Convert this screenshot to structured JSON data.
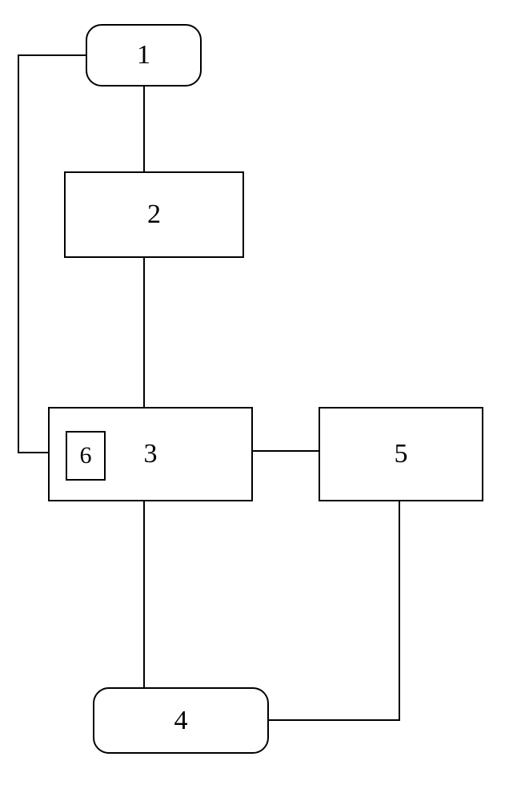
{
  "blocks": {
    "b1": "1",
    "b2": "2",
    "b3": "3",
    "b4": "4",
    "b5": "5",
    "b6": "6"
  }
}
